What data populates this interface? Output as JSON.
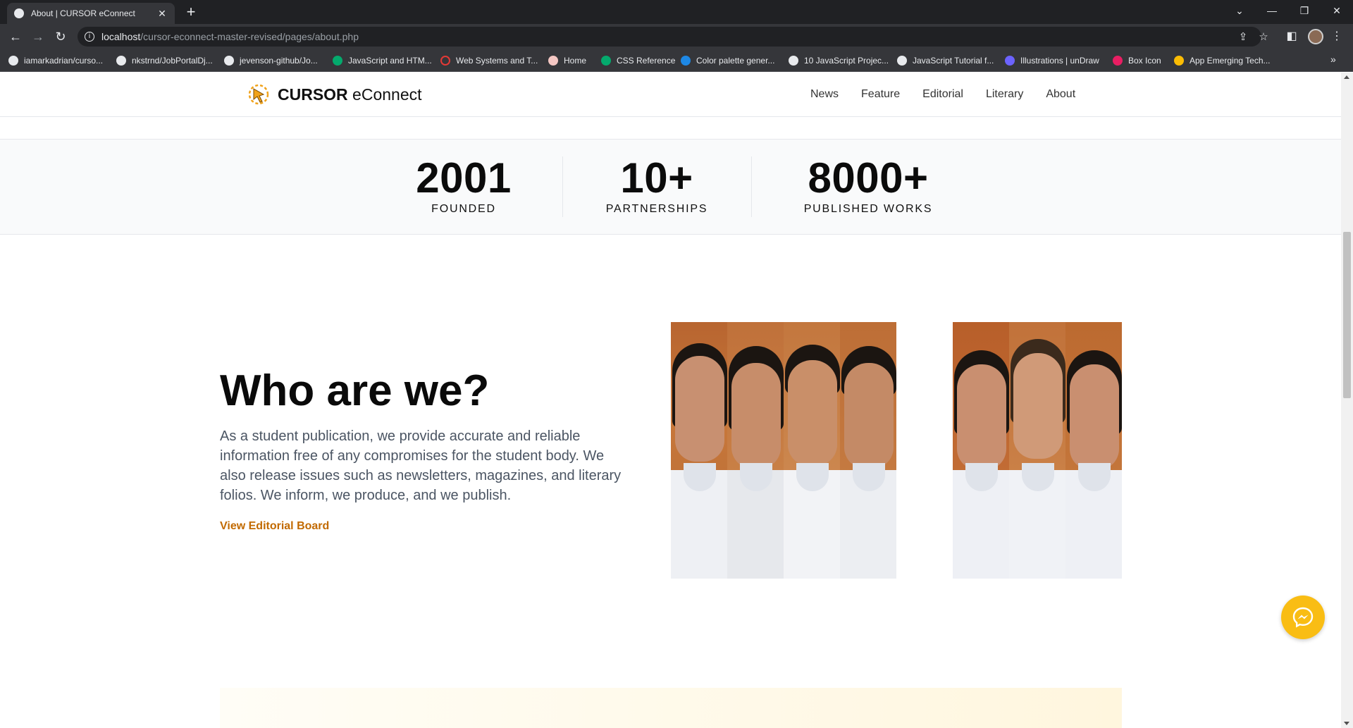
{
  "browser": {
    "tab_title": "About | CURSOR eConnect",
    "tab_close": "✕",
    "new_tab": "+",
    "url_host": "localhost",
    "url_path": "/cursor-econnect-master-revised/pages/about.php",
    "window_controls": {
      "dropdown": "⌄",
      "minimize": "—",
      "restore": "❐",
      "close": "✕"
    },
    "bookmarks": [
      {
        "label": "iamarkadrian/curso...",
        "icon": "github-icon",
        "color": "#e8eaed"
      },
      {
        "label": "nkstrnd/JobPortalDj...",
        "icon": "github-icon",
        "color": "#e8eaed"
      },
      {
        "label": "jevenson-github/Jo...",
        "icon": "github-icon",
        "color": "#e8eaed"
      },
      {
        "label": "JavaScript and HTM...",
        "icon": "w3schools-icon",
        "color": "#04aa6d"
      },
      {
        "label": "Web Systems and T...",
        "icon": "ring-icon",
        "color": "#e53935"
      },
      {
        "label": "Home",
        "icon": "home-favicon",
        "color": "#f4c7c3"
      },
      {
        "label": "CSS Reference",
        "icon": "w3schools-icon",
        "color": "#04aa6d"
      },
      {
        "label": "Color palette gener...",
        "icon": "coolors-icon",
        "color": "#1e88e5"
      },
      {
        "label": "10 JavaScript Projec...",
        "icon": "codepen-icon",
        "color": "#e8eaed"
      },
      {
        "label": "JavaScript Tutorial f...",
        "icon": "codepen-icon",
        "color": "#e8eaed"
      },
      {
        "label": "Illustrations | unDraw",
        "icon": "undraw-icon",
        "color": "#6c63ff"
      },
      {
        "label": "Box Icon",
        "icon": "boxicon-icon",
        "color": "#e91e63"
      },
      {
        "label": "App Emerging Tech...",
        "icon": "drive-icon",
        "color": "#fbbc04"
      }
    ],
    "bookmarks_more": "»"
  },
  "site": {
    "brand_bold": "CURSOR",
    "brand_light": " eConnect",
    "nav": [
      "News",
      "Feature",
      "Editorial",
      "Literary",
      "About"
    ],
    "stats": [
      {
        "value": "2001",
        "label": "FOUNDED"
      },
      {
        "value": "10+",
        "label": "PARTNERSHIPS"
      },
      {
        "value": "8000+",
        "label": "PUBLISHED WORKS"
      }
    ],
    "who": {
      "title": "Who are we?",
      "text": "As a student publication, we provide accurate and reliable information free of any compromises for the student body. We also release issues such as newsletters, magazines, and literary folios. We inform, we produce, and we publish.",
      "link": "View Editorial Board"
    }
  },
  "colors": {
    "accent": "#c26a00",
    "messenger": "#f9bd14",
    "stats_band": "#f9fafb"
  }
}
